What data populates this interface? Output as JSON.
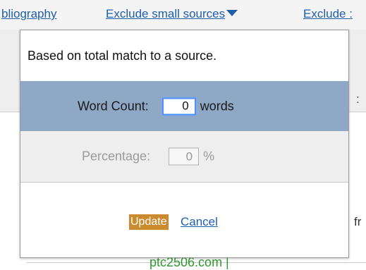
{
  "toolbar": {
    "bibliography_label": "bliography",
    "exclude_small_label": "Exclude small sources",
    "exclude_more_label": "Exclude :"
  },
  "background": {
    "source_text": "ptc2506.com |",
    "fragment_text": "fr",
    "colon_text": ":"
  },
  "popup": {
    "description": "Based on total match to a source.",
    "word_count": {
      "label": "Word Count:",
      "value": "0",
      "unit": "words"
    },
    "percentage": {
      "label": "Percentage:",
      "value": "0",
      "unit": "%"
    },
    "update_label": "Update",
    "cancel_label": "Cancel"
  },
  "colors": {
    "link": "#1f5fa8",
    "selected_row": "#8fa8c6",
    "disabled_row": "#eeeeee",
    "update_button": "#cc8a2e",
    "source_link": "#2e9a2e"
  }
}
